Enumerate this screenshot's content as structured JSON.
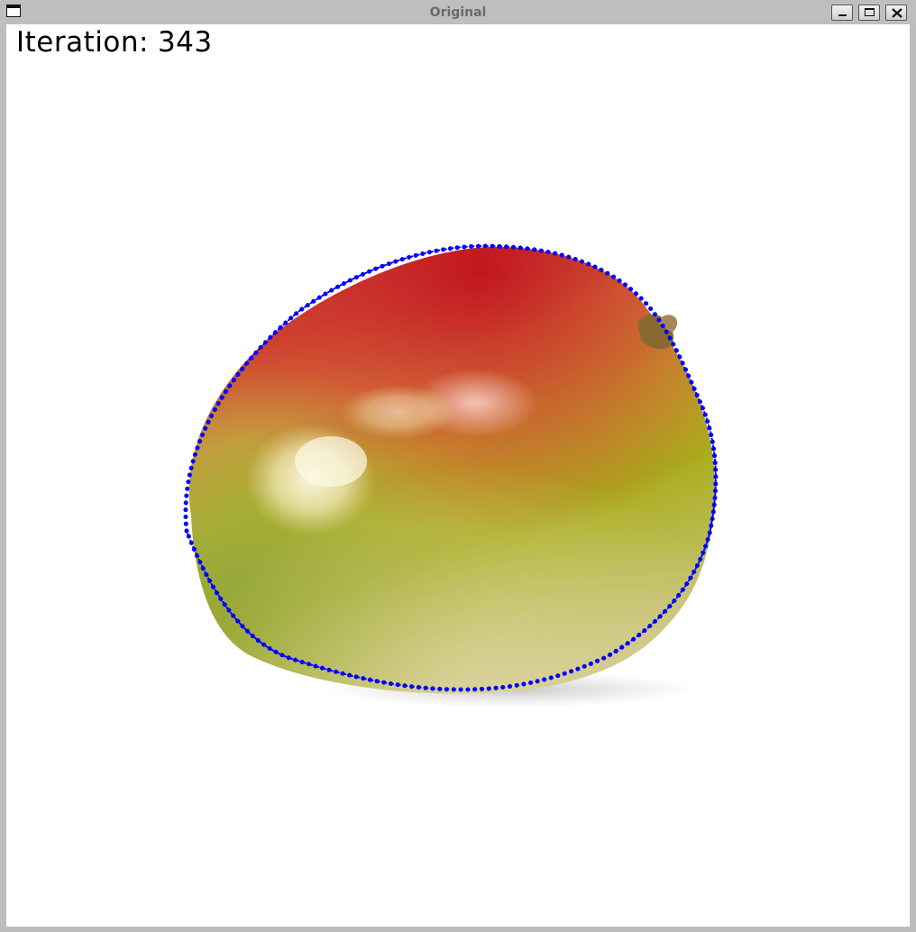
{
  "window": {
    "title": "Original",
    "buttons": {
      "minimize": "minimize-icon",
      "maximize": "maximize-icon",
      "close": "close-icon"
    }
  },
  "overlay": {
    "label": "Iteration:",
    "value": "343"
  },
  "colors": {
    "contour": "#0000ff",
    "background": "#ffffff",
    "titlebar": "#bebebe"
  }
}
